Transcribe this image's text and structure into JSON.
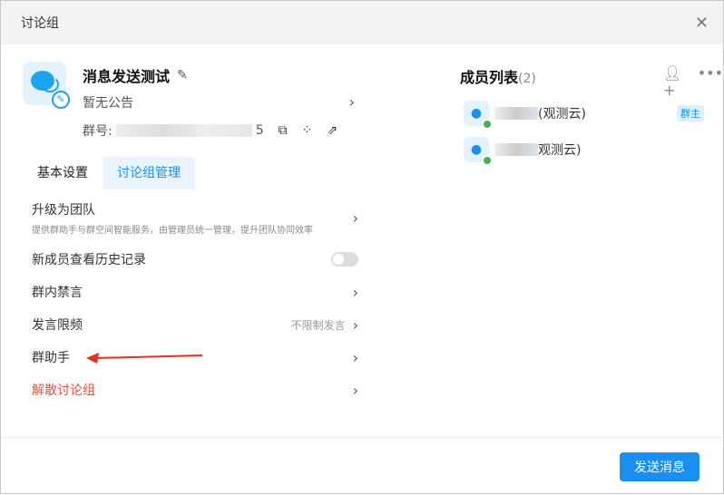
{
  "window": {
    "title": "讨论组"
  },
  "group": {
    "name": "消息发送测试",
    "notice": "暂无公告",
    "id_label": "群号:",
    "id_suffix": "5"
  },
  "tabs": [
    {
      "label": "基本设置",
      "active": false
    },
    {
      "label": "讨论组管理",
      "active": true
    }
  ],
  "settings": [
    {
      "label": "升级为团队",
      "sub": "提供群助手与群空间智能服务，由管理员统一管理，提升团队协同效率"
    },
    {
      "label": "新成员查看历史记录",
      "toggle": false
    },
    {
      "label": "群内禁言"
    },
    {
      "label": "发言限频",
      "value": "不限制发言"
    },
    {
      "label": "群助手"
    },
    {
      "label": "解散讨论组",
      "danger": true
    }
  ],
  "members": {
    "title": "成员列表",
    "count": "(2)",
    "items": [
      {
        "name_suffix": "(观测云)",
        "badge": "群主"
      },
      {
        "name_suffix": "观测云)"
      }
    ]
  },
  "footer": {
    "send": "发送消息"
  },
  "colors": {
    "accent": "#1a8ff0",
    "danger": "#e0503c",
    "annotation": "#e53020"
  }
}
